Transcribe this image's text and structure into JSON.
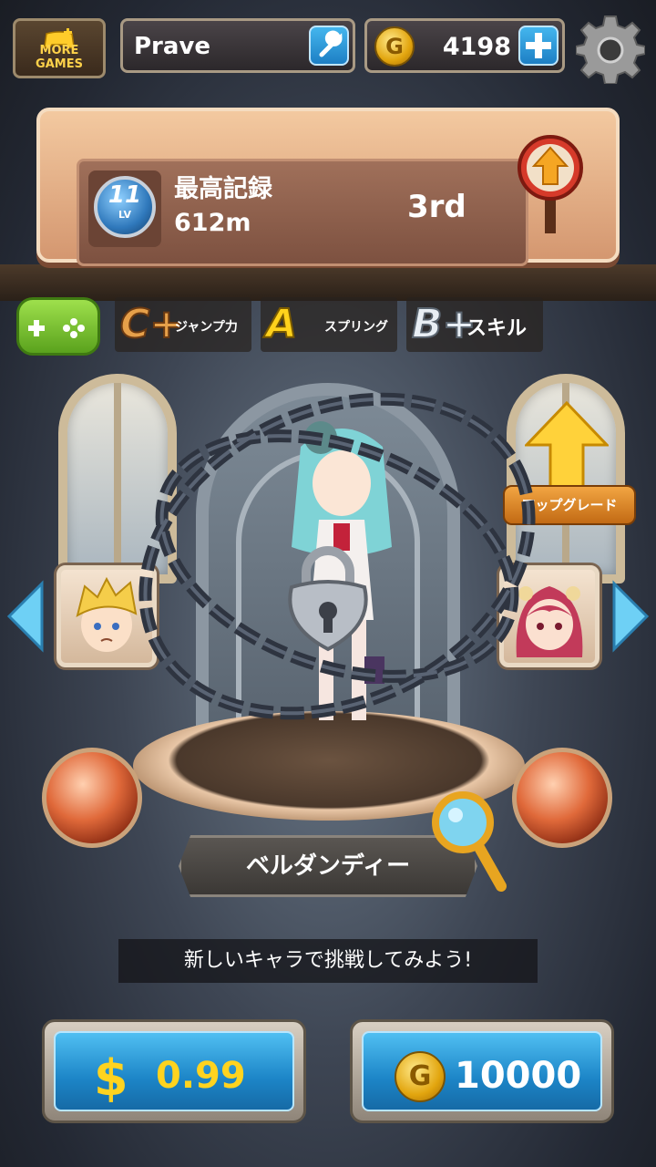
{
  "header": {
    "more_games_label": "MORE GAMES",
    "player_name": "Prave",
    "coin_amount": "4198"
  },
  "record": {
    "level": "11",
    "level_tag": "LV",
    "title": "最高記録",
    "distance": "612m",
    "rank": "3rd"
  },
  "stats": [
    {
      "grade": "C+",
      "label": "ジャンプ力"
    },
    {
      "grade": "A",
      "label": "スプリング"
    },
    {
      "grade": "B+",
      "label": "スキル"
    }
  ],
  "upgrade_label": "アップグレード",
  "character": {
    "name": "ベルダンディー",
    "prompt": "新しいキャラで挑戦してみよう!"
  },
  "purchase": {
    "money_price": "0.99",
    "coin_price": "10000"
  },
  "colors": {
    "button_blue": "#1c85c7",
    "coin_gold": "#e2a50e",
    "price_yellow": "#ffd31f",
    "board_wood": "#d49770"
  },
  "icons": [
    "gamepad-plus-icon",
    "wrench-icon",
    "coin-icon",
    "plus-icon",
    "gear-icon",
    "up-arrow-sign-icon",
    "gamepad-icon",
    "lock-icon",
    "chain-icon",
    "magnifier-icon",
    "left-arrow-icon",
    "right-arrow-icon"
  ]
}
